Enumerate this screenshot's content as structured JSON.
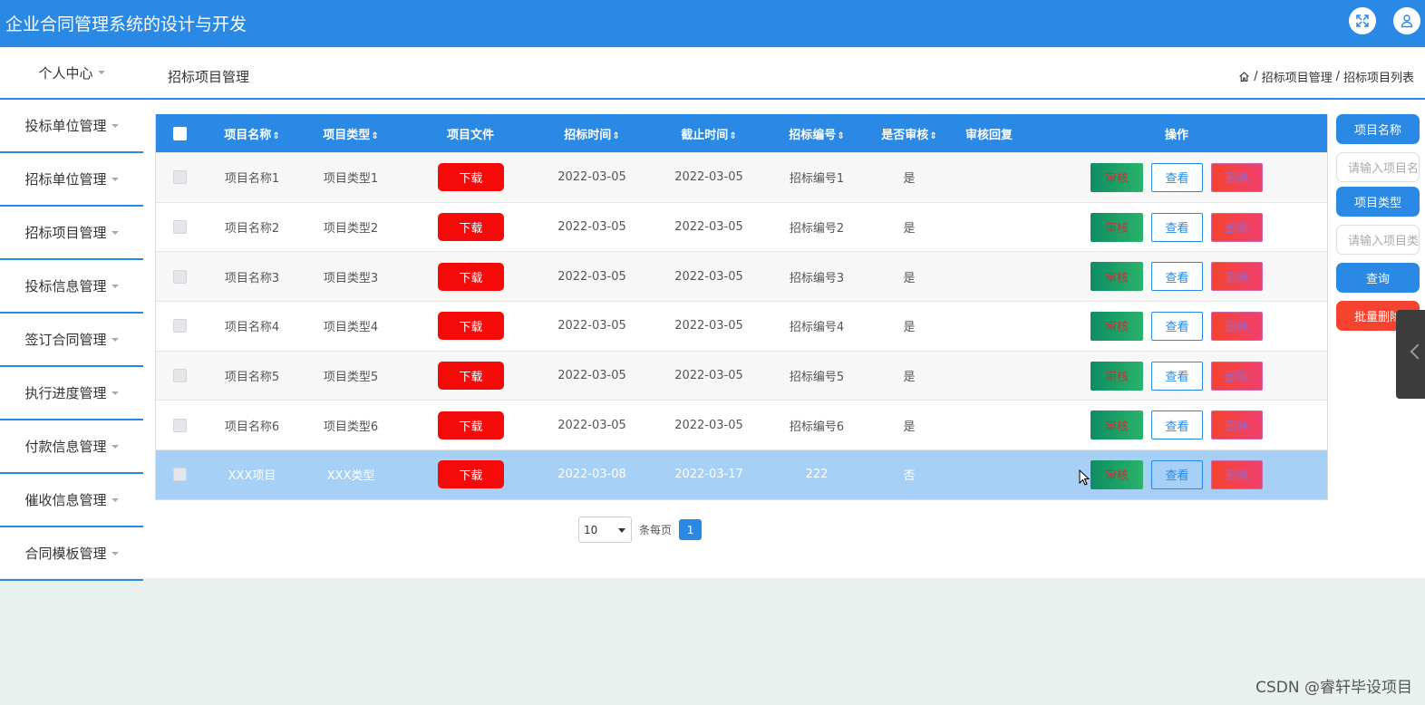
{
  "app": {
    "title": "企业合同管理系统的设计与开发"
  },
  "icons": {
    "fullscreen": "fullscreen-icon",
    "user": "user-icon",
    "home": "home-icon"
  },
  "colors": {
    "primary": "#2a89e5",
    "danger": "#f50a0a",
    "success": "#0e8d63",
    "bg": "#e8f1ee"
  },
  "sidebar": {
    "items": [
      {
        "label": "个人中心"
      },
      {
        "label": "投标单位管理"
      },
      {
        "label": "招标单位管理"
      },
      {
        "label": "招标项目管理"
      },
      {
        "label": "投标信息管理"
      },
      {
        "label": "签订合同管理"
      },
      {
        "label": "执行进度管理"
      },
      {
        "label": "付款信息管理"
      },
      {
        "label": "催收信息管理"
      },
      {
        "label": "合同模板管理"
      }
    ]
  },
  "page": {
    "title": "招标项目管理"
  },
  "breadcrumb": [
    "招标项目管理",
    "招标项目列表"
  ],
  "breadcrumb_sep": "/",
  "table": {
    "headers": {
      "name": "项目名称",
      "type": "项目类型",
      "file": "项目文件",
      "bid_time": "招标时间",
      "end_time": "截止时间",
      "code": "招标编号",
      "audited": "是否审核",
      "reply": "审核回复",
      "ops": "操作"
    },
    "sort_icon": "⇕",
    "rows": [
      {
        "name": "项目名称1",
        "type": "项目类型1",
        "file": "下载",
        "bid_time": "2022-03-05",
        "end_time": "2022-03-05",
        "code": "招标编号1",
        "audited": "是",
        "reply": ""
      },
      {
        "name": "项目名称2",
        "type": "项目类型2",
        "file": "下载",
        "bid_time": "2022-03-05",
        "end_time": "2022-03-05",
        "code": "招标编号2",
        "audited": "是",
        "reply": ""
      },
      {
        "name": "项目名称3",
        "type": "项目类型3",
        "file": "下载",
        "bid_time": "2022-03-05",
        "end_time": "2022-03-05",
        "code": "招标编号3",
        "audited": "是",
        "reply": ""
      },
      {
        "name": "项目名称4",
        "type": "项目类型4",
        "file": "下载",
        "bid_time": "2022-03-05",
        "end_time": "2022-03-05",
        "code": "招标编号4",
        "audited": "是",
        "reply": ""
      },
      {
        "name": "项目名称5",
        "type": "项目类型5",
        "file": "下载",
        "bid_time": "2022-03-05",
        "end_time": "2022-03-05",
        "code": "招标编号5",
        "audited": "是",
        "reply": ""
      },
      {
        "name": "项目名称6",
        "type": "项目类型6",
        "file": "下载",
        "bid_time": "2022-03-05",
        "end_time": "2022-03-05",
        "code": "招标编号6",
        "audited": "是",
        "reply": ""
      },
      {
        "name": "XXX项目",
        "type": "XXX类型",
        "file": "下载",
        "bid_time": "2022-03-08",
        "end_time": "2022-03-17",
        "code": "222",
        "audited": "否",
        "reply": ""
      }
    ],
    "actions": {
      "audit": "审核",
      "view": "查看",
      "delete": "删除"
    }
  },
  "pager": {
    "page_size": "10",
    "per_page_label": "条每页",
    "current_page": "1"
  },
  "search": {
    "name_label": "项目名称",
    "name_placeholder": "请输入项目名称",
    "type_label": "项目类型",
    "type_placeholder": "请输入项目类型",
    "query": "查询",
    "batch_delete": "批量删除"
  },
  "watermark": "CSDN @睿轩毕设项目"
}
